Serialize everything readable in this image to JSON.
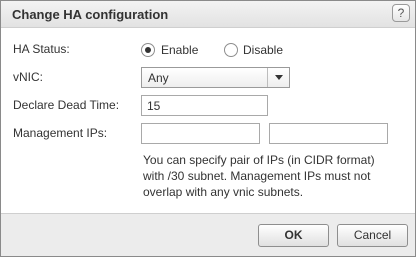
{
  "dialog": {
    "title": "Change HA configuration",
    "help_glyph": "?"
  },
  "form": {
    "ha_status": {
      "label": "HA Status:",
      "options": [
        {
          "label": "Enable",
          "selected": true
        },
        {
          "label": "Disable",
          "selected": false
        }
      ]
    },
    "vnic": {
      "label": "vNIC:",
      "selected": "Any"
    },
    "dead_time": {
      "label": "Declare Dead Time:",
      "value": "15"
    },
    "management_ips": {
      "label": "Management IPs:",
      "value_1": "",
      "value_2": "",
      "hint": "You can specify pair of IPs (in CIDR format) with /30 subnet. Management IPs must not overlap with any vnic subnets."
    }
  },
  "buttons": {
    "ok": "OK",
    "cancel": "Cancel"
  }
}
